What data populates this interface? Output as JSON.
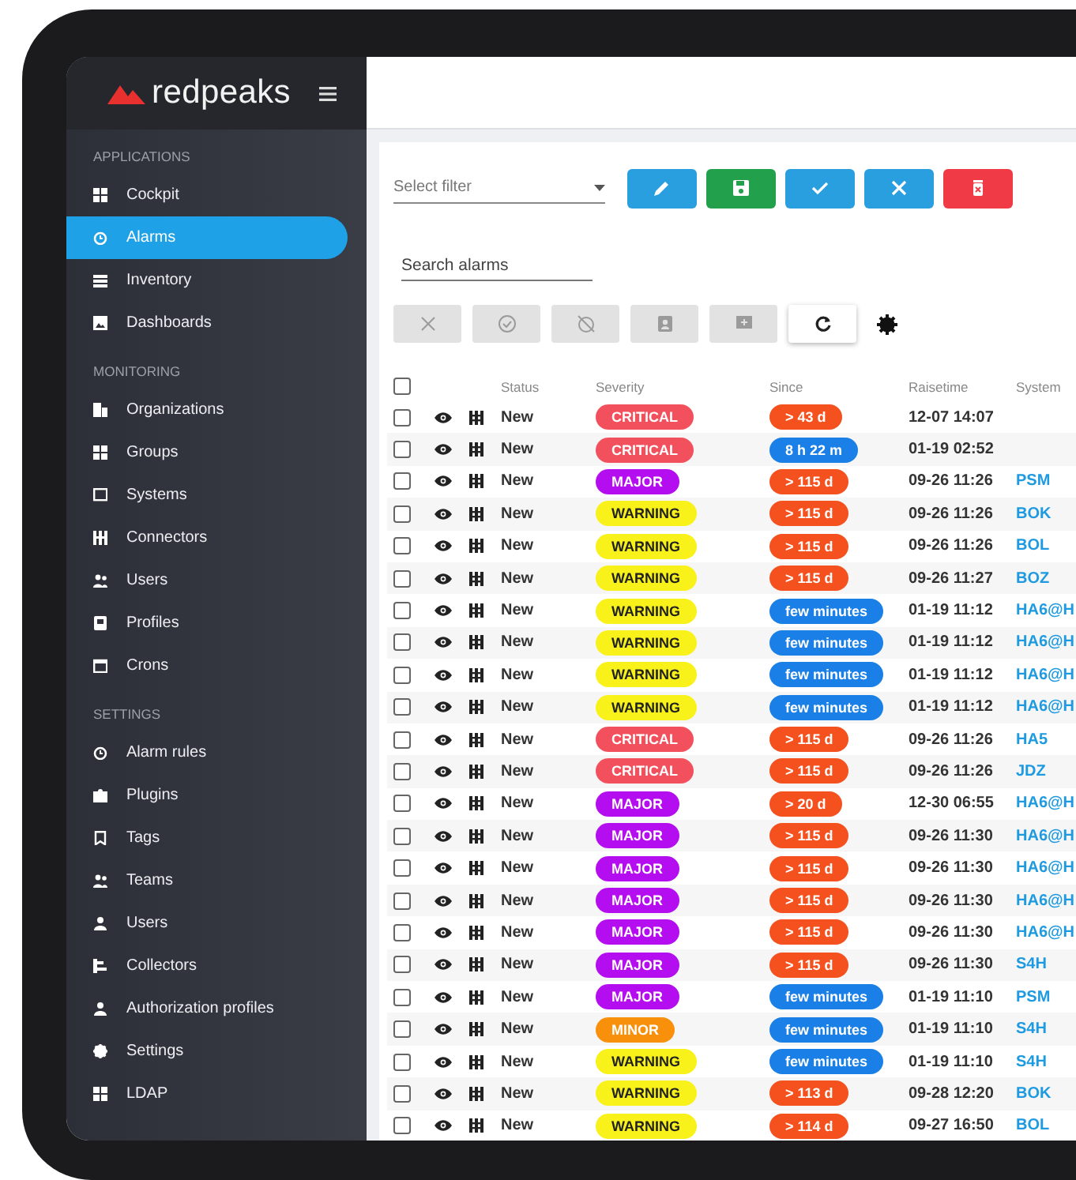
{
  "sidebar": {
    "logo": "redpeaks",
    "sections": [
      {
        "heading": "APPLICATIONS",
        "items": [
          {
            "label": "Cockpit",
            "selected": false
          },
          {
            "label": "Alarms",
            "selected": true
          },
          {
            "label": "Inventory",
            "selected": false
          },
          {
            "label": "Dashboards",
            "selected": false
          }
        ]
      },
      {
        "heading": "MONITORING",
        "items": [
          {
            "label": "Organizations",
            "selected": false
          },
          {
            "label": "Groups",
            "selected": false
          },
          {
            "label": "Systems",
            "selected": false
          },
          {
            "label": "Connectors",
            "selected": false
          },
          {
            "label": "Users",
            "selected": false
          },
          {
            "label": "Profiles",
            "selected": false
          },
          {
            "label": "Crons",
            "selected": false
          }
        ]
      },
      {
        "heading": "SETTINGS",
        "items": [
          {
            "label": "Alarm rules",
            "selected": false
          },
          {
            "label": "Plugins",
            "selected": false
          },
          {
            "label": "Tags",
            "selected": false
          },
          {
            "label": "Teams",
            "selected": false
          },
          {
            "label": "Users",
            "selected": false
          },
          {
            "label": "Collectors",
            "selected": false
          },
          {
            "label": "Authorization profiles",
            "selected": false
          },
          {
            "label": "Settings",
            "selected": false
          },
          {
            "label": "LDAP",
            "selected": false
          }
        ]
      }
    ]
  },
  "filter": {
    "placeholder": "Select filter"
  },
  "filter_buttons": [
    {
      "color": "#2a9fe0"
    },
    {
      "color": "#22a04b"
    },
    {
      "color": "#2a9fe0"
    },
    {
      "color": "#2a9fe0"
    },
    {
      "color": "#f03a45"
    }
  ],
  "search": {
    "placeholder": "Search alarms"
  },
  "action_buttons": [
    {
      "disabled": true
    },
    {
      "disabled": true
    },
    {
      "disabled": true
    },
    {
      "disabled": true
    },
    {
      "disabled": true
    },
    {
      "disabled": false
    }
  ],
  "table": {
    "select_all_checked": false,
    "columns": [
      "Status",
      "Severity",
      "Since",
      "Raisetime",
      "System"
    ],
    "rows": [
      {
        "checked": false,
        "status": "New",
        "severity": {
          "label": "CRITICAL",
          "color": "#f2505c"
        },
        "since": {
          "label": "> 43 d",
          "color": "#f4511e"
        },
        "raisetime": "12-07 14:07"
      },
      {
        "checked": false,
        "status": "New",
        "severity": {
          "label": "CRITICAL",
          "color": "#f2505c"
        },
        "since": {
          "label": "8 h 22 m",
          "color": "#1a7fe6"
        },
        "raisetime": "01-19 02:52"
      },
      {
        "checked": false,
        "status": "New",
        "severity": {
          "label": "MAJOR",
          "color": "#b40ef0"
        },
        "since": {
          "label": "> 115 d",
          "color": "#f4511e"
        },
        "raisetime": "09-26 11:26",
        "system": "PSM"
      },
      {
        "checked": false,
        "status": "New",
        "severity": {
          "label": "WARNING",
          "color": "#f8f21a"
        },
        "since": {
          "label": "> 115 d",
          "color": "#f4511e"
        },
        "raisetime": "09-26 11:26",
        "system": "BOK"
      },
      {
        "checked": false,
        "status": "New",
        "severity": {
          "label": "WARNING",
          "color": "#f8f21a"
        },
        "since": {
          "label": "> 115 d",
          "color": "#f4511e"
        },
        "raisetime": "09-26 11:26",
        "system": "BOL"
      },
      {
        "checked": false,
        "status": "New",
        "severity": {
          "label": "WARNING",
          "color": "#f8f21a"
        },
        "since": {
          "label": "> 115 d",
          "color": "#f4511e"
        },
        "raisetime": "09-26 11:27",
        "system": "BOZ"
      },
      {
        "checked": false,
        "status": "New",
        "severity": {
          "label": "WARNING",
          "color": "#f8f21a"
        },
        "since": {
          "label": "few minutes",
          "color": "#1a7fe6"
        },
        "raisetime": "01-19 11:12",
        "system": "HA6@H"
      },
      {
        "checked": false,
        "status": "New",
        "severity": {
          "label": "WARNING",
          "color": "#f8f21a"
        },
        "since": {
          "label": "few minutes",
          "color": "#1a7fe6"
        },
        "raisetime": "01-19 11:12",
        "system": "HA6@H"
      },
      {
        "checked": false,
        "status": "New",
        "severity": {
          "label": "WARNING",
          "color": "#f8f21a"
        },
        "since": {
          "label": "few minutes",
          "color": "#1a7fe6"
        },
        "raisetime": "01-19 11:12",
        "system": "HA6@H"
      },
      {
        "checked": false,
        "status": "New",
        "severity": {
          "label": "WARNING",
          "color": "#f8f21a"
        },
        "since": {
          "label": "few minutes",
          "color": "#1a7fe6"
        },
        "raisetime": "01-19 11:12",
        "system": "HA6@H"
      },
      {
        "checked": false,
        "status": "New",
        "severity": {
          "label": "CRITICAL",
          "color": "#f2505c"
        },
        "since": {
          "label": "> 115 d",
          "color": "#f4511e"
        },
        "raisetime": "09-26 11:26",
        "system": "HA5"
      },
      {
        "checked": false,
        "status": "New",
        "severity": {
          "label": "CRITICAL",
          "color": "#f2505c"
        },
        "since": {
          "label": "> 115 d",
          "color": "#f4511e"
        },
        "raisetime": "09-26 11:26",
        "system": "JDZ"
      },
      {
        "checked": false,
        "status": "New",
        "severity": {
          "label": "MAJOR",
          "color": "#b40ef0"
        },
        "since": {
          "label": "> 20 d",
          "color": "#f4511e"
        },
        "raisetime": "12-30 06:55",
        "system": "HA6@H"
      },
      {
        "checked": false,
        "status": "New",
        "severity": {
          "label": "MAJOR",
          "color": "#b40ef0"
        },
        "since": {
          "label": "> 115 d",
          "color": "#f4511e"
        },
        "raisetime": "09-26 11:30",
        "system": "HA6@H"
      },
      {
        "checked": false,
        "status": "New",
        "severity": {
          "label": "MAJOR",
          "color": "#b40ef0"
        },
        "since": {
          "label": "> 115 d",
          "color": "#f4511e"
        },
        "raisetime": "09-26 11:30",
        "system": "HA6@H"
      },
      {
        "checked": false,
        "status": "New",
        "severity": {
          "label": "MAJOR",
          "color": "#b40ef0"
        },
        "since": {
          "label": "> 115 d",
          "color": "#f4511e"
        },
        "raisetime": "09-26 11:30",
        "system": "HA6@H"
      },
      {
        "checked": false,
        "status": "New",
        "severity": {
          "label": "MAJOR",
          "color": "#b40ef0"
        },
        "since": {
          "label": "> 115 d",
          "color": "#f4511e"
        },
        "raisetime": "09-26 11:30",
        "system": "HA6@H"
      },
      {
        "checked": false,
        "status": "New",
        "severity": {
          "label": "MAJOR",
          "color": "#b40ef0"
        },
        "since": {
          "label": "> 115 d",
          "color": "#f4511e"
        },
        "raisetime": "09-26 11:30",
        "system": "S4H"
      },
      {
        "checked": false,
        "status": "New",
        "severity": {
          "label": "MAJOR",
          "color": "#b40ef0"
        },
        "since": {
          "label": "few minutes",
          "color": "#1a7fe6"
        },
        "raisetime": "01-19 11:10",
        "system": "PSM"
      },
      {
        "checked": false,
        "status": "New",
        "severity": {
          "label": "MINOR",
          "color": "#f8900c"
        },
        "since": {
          "label": "few minutes",
          "color": "#1a7fe6"
        },
        "raisetime": "01-19 11:10",
        "system": "S4H"
      },
      {
        "checked": false,
        "status": "New",
        "severity": {
          "label": "WARNING",
          "color": "#f8f21a"
        },
        "since": {
          "label": "few minutes",
          "color": "#1a7fe6"
        },
        "raisetime": "01-19 11:10",
        "system": "S4H"
      },
      {
        "checked": false,
        "status": "New",
        "severity": {
          "label": "WARNING",
          "color": "#f8f21a"
        },
        "since": {
          "label": "> 113 d",
          "color": "#f4511e"
        },
        "raisetime": "09-28 12:20",
        "system": "BOK"
      },
      {
        "checked": false,
        "status": "New",
        "severity": {
          "label": "WARNING",
          "color": "#f8f21a"
        },
        "since": {
          "label": "> 114 d",
          "color": "#f4511e"
        },
        "raisetime": "09-27 16:50",
        "system": "BOL"
      }
    ]
  }
}
